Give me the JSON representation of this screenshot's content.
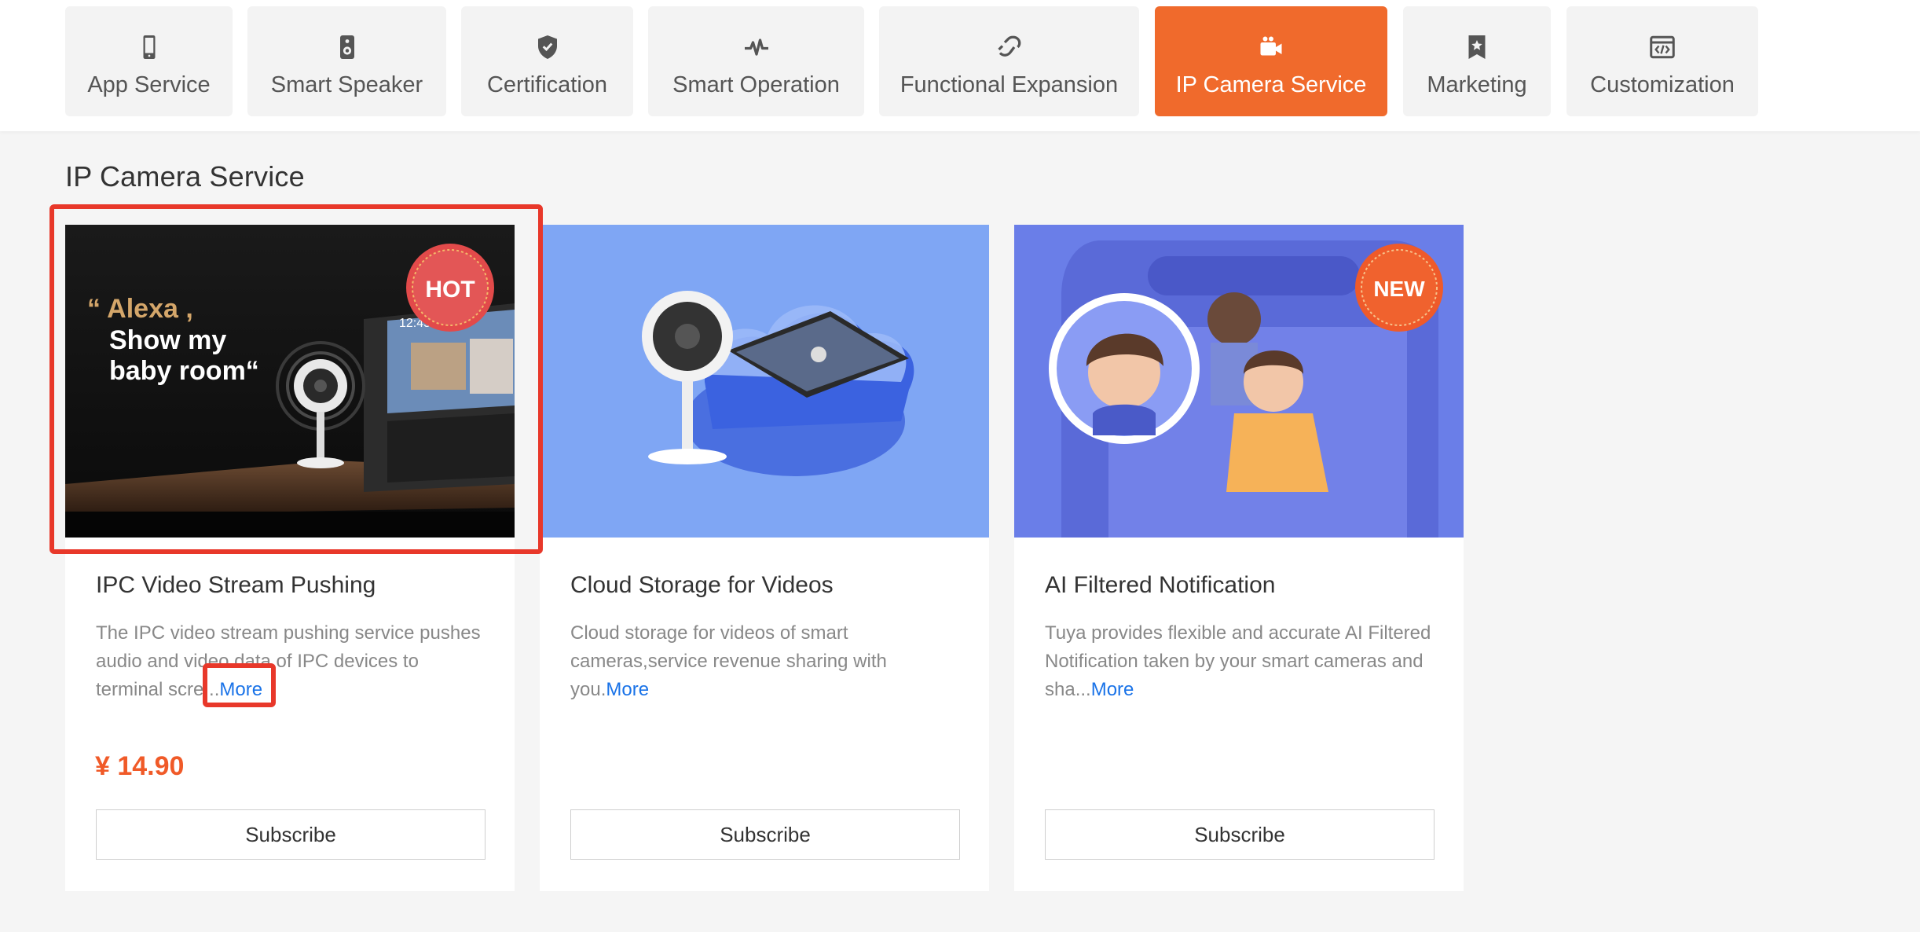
{
  "tabs": [
    {
      "label": "App Service",
      "icon": "phone-icon"
    },
    {
      "label": "Smart Speaker",
      "icon": "speaker-icon"
    },
    {
      "label": "Certification",
      "icon": "shield-icon"
    },
    {
      "label": "Smart Operation",
      "icon": "pulse-icon"
    },
    {
      "label": "Functional Expansion",
      "icon": "plug-icon"
    },
    {
      "label": "IP Camera Service",
      "icon": "camera-icon",
      "active": true
    },
    {
      "label": "Marketing",
      "icon": "bookmark-star-icon"
    },
    {
      "label": "Customization",
      "icon": "code-window-icon"
    }
  ],
  "section_title": "IP Camera Service",
  "cards": [
    {
      "title": "IPC Video Stream Pushing",
      "desc": "The IPC video stream pushing service pushes audio and video data of IPC devices to terminal scre...",
      "more": "More",
      "price": "¥ 14.90",
      "button": "Subscribe",
      "badge": "HOT",
      "image_text": [
        "“ Alexa ,",
        "Show my",
        "baby room“"
      ],
      "screen_text": "12:45"
    },
    {
      "title": "Cloud Storage for Videos",
      "desc": "Cloud storage for videos of smart cameras,service revenue sharing with you.",
      "more": "More",
      "button": "Subscribe"
    },
    {
      "title": "AI Filtered Notification",
      "desc": "Tuya provides flexible and accurate AI Filtered Notification taken by your smart cameras and sha...",
      "more": "More",
      "button": "Subscribe",
      "badge": "NEW"
    }
  ],
  "colors": {
    "accent": "#f06a2c",
    "price": "#f05a28",
    "link": "#1a73e8",
    "highlight": "#e8382a"
  }
}
